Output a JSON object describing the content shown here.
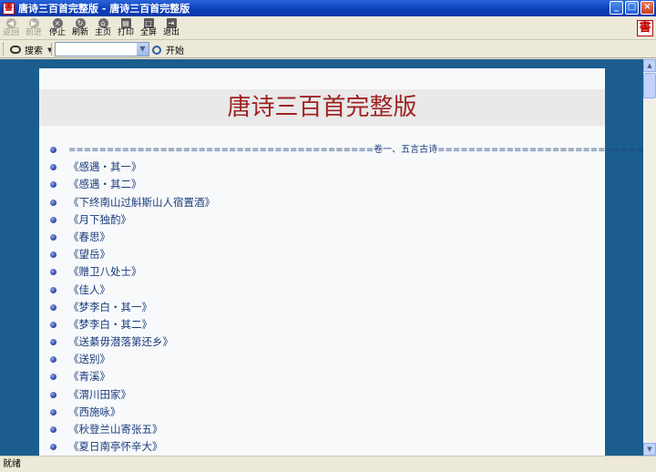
{
  "window": {
    "title": "唐诗三百首完整版 - 唐诗三百首完整版",
    "app_icon": "book-icon",
    "controls": [
      "minimize",
      "maximize",
      "close"
    ]
  },
  "toolbar": {
    "buttons": [
      {
        "label": "返回",
        "icon": "back-icon",
        "disabled": true
      },
      {
        "label": "前进",
        "icon": "forward-icon",
        "disabled": true
      },
      {
        "label": "停止",
        "icon": "stop-icon",
        "disabled": false
      },
      {
        "label": "刷新",
        "icon": "refresh-icon",
        "disabled": false
      },
      {
        "label": "主页",
        "icon": "home-icon",
        "disabled": false
      },
      {
        "label": "打印",
        "icon": "print-icon",
        "disabled": false
      },
      {
        "label": "全屏",
        "icon": "fullscreen-icon",
        "disabled": false
      },
      {
        "label": "退出",
        "icon": "exit-icon",
        "disabled": false
      }
    ],
    "logo_char": "書"
  },
  "searchbar": {
    "search_label": "搜索",
    "combo_value": "",
    "go_label": "开始"
  },
  "page": {
    "title": "唐诗三百首完整版",
    "section": "========================================卷一、五言古诗=========================================",
    "items": [
      "《感遇・其一》",
      "《感遇・其二》",
      "《下终南山过斛斯山人宿置酒》",
      "《月下独酌》",
      "《春思》",
      "《望岳》",
      "《赠卫八处士》",
      "《佳人》",
      "《梦李白・其一》",
      "《梦李白・其二》",
      "《送綦毋潜落第还乡》",
      "《送别》",
      "《青溪》",
      "《渭川田家》",
      "《西施咏》",
      "《秋登兰山寄张五》",
      "《夏日南亭怀辛大》"
    ]
  },
  "status": "就绪",
  "colors": {
    "background": "#1b5e8e",
    "title": "#a02222",
    "link": "#1a3d7c"
  }
}
